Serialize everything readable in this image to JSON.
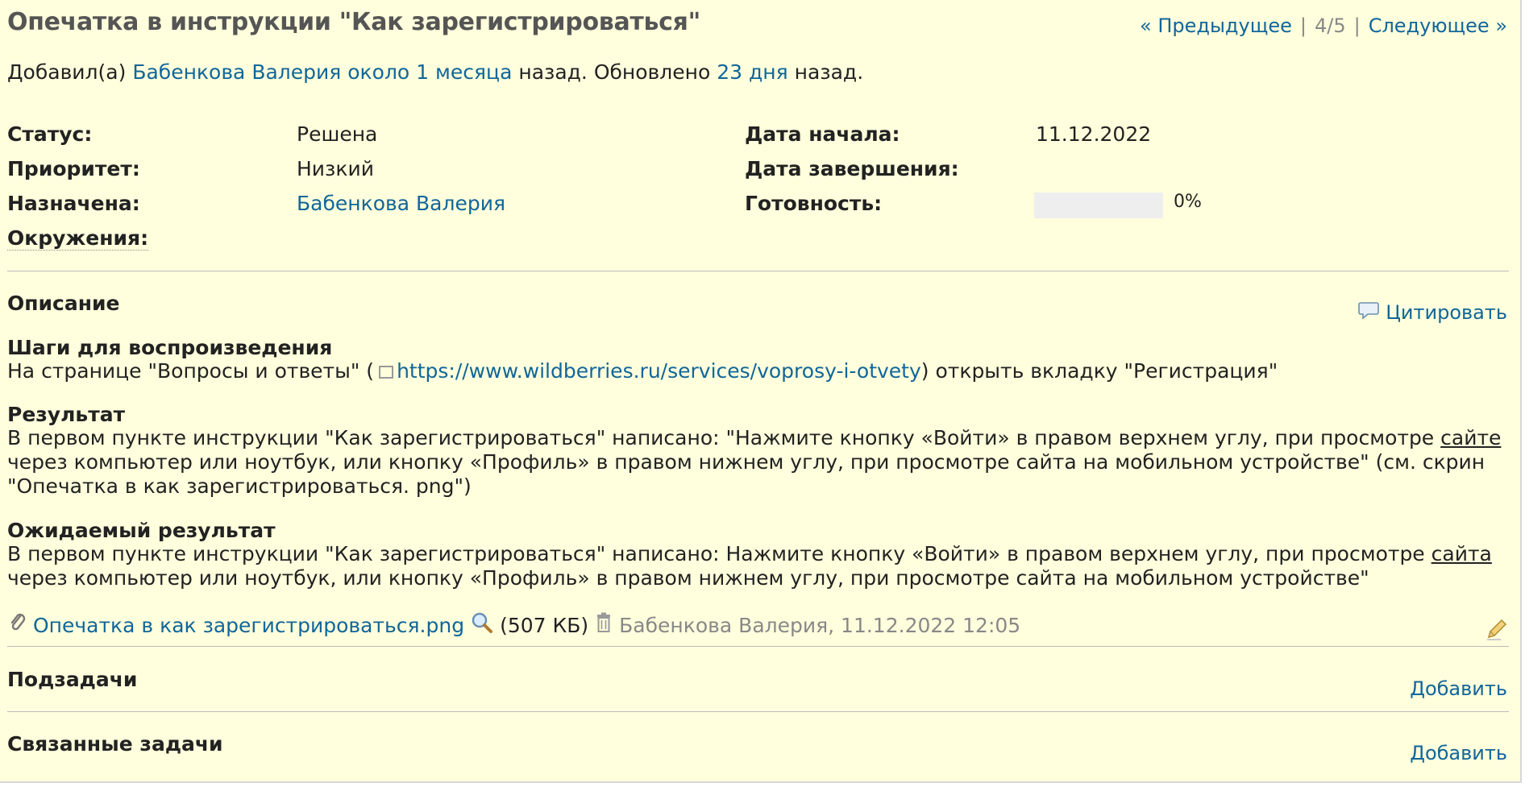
{
  "issue": {
    "title": "Опечатка в инструкции \"Как зарегистрироваться\"",
    "pager": {
      "prev": "« Предыдущее",
      "sep1": "|",
      "position": "4/5",
      "sep2": "|",
      "next": "Следующее »"
    },
    "author_line": {
      "added_by": "Добавил(а)",
      "author": "Бабенкова Валерия",
      "added_ago": "около 1 месяца",
      "ago_suffix": "назад. Обновлено",
      "updated_ago": "23 дня",
      "updated_suffix": "назад."
    },
    "attributes": {
      "status": {
        "label": "Статус:",
        "value": "Решена"
      },
      "priority": {
        "label": "Приоритет:",
        "value": "Низкий"
      },
      "assignee": {
        "label": "Назначена:",
        "value": "Бабенкова Валерия"
      },
      "environment": {
        "label": "Окружения:",
        "value": ""
      },
      "start_date": {
        "label": "Дата начала:",
        "value": "11.12.2022"
      },
      "due_date": {
        "label": "Дата завершения:",
        "value": ""
      },
      "done_ratio": {
        "label": "Готовность:",
        "value": "0%",
        "fraction": 0
      }
    },
    "description": {
      "heading": "Описание",
      "quote_label": "Цитировать",
      "steps_heading": "Шаги для воспроизведения",
      "steps_before": "На странице \"Вопросы и ответы\" (",
      "steps_link": "https://www.wildberries.ru/services/voprosy-i-otvety",
      "steps_after": ") открыть вкладку \"Регистрация\"",
      "result_heading": "Результат",
      "result_before": "В первом пункте инструкции \"Как зарегистрироваться\" написано: \"Нажмите кнопку «Войти» в правом верхнем углу, при просмотре",
      "result_underlined": "сайте",
      "result_after": "через компьютер или ноутбук, или кнопку «Профиль» в правом нижнем углу, при просмотре сайта на мобильном устройстве\" (см. скрин \"Опечатка в как зарегистрироваться. png\")",
      "expected_heading": "Ожидаемый результат",
      "expected_before": "В первом пункте инструкции \"Как зарегистрироваться\" написано: Нажмите кнопку «Войти» в правом верхнем углу, при просмотре",
      "expected_underlined": "сайта",
      "expected_after": "через компьютер или ноутбук, или кнопку «Профиль» в правом нижнем углу, при просмотре сайта на мобильном устройстве\""
    },
    "attachment": {
      "filename": "Опечатка в как зарегистрироваться.png",
      "size": "(507 КБ)",
      "meta": "Бабенкова Валерия, 11.12.2022 12:05"
    },
    "subtasks": {
      "heading": "Подзадачи",
      "add_label": "Добавить"
    },
    "related": {
      "heading": "Связанные задачи",
      "add_label": "Добавить"
    }
  },
  "colors": {
    "background": "#ffffdd",
    "link": "#116699",
    "muted": "#888888"
  }
}
